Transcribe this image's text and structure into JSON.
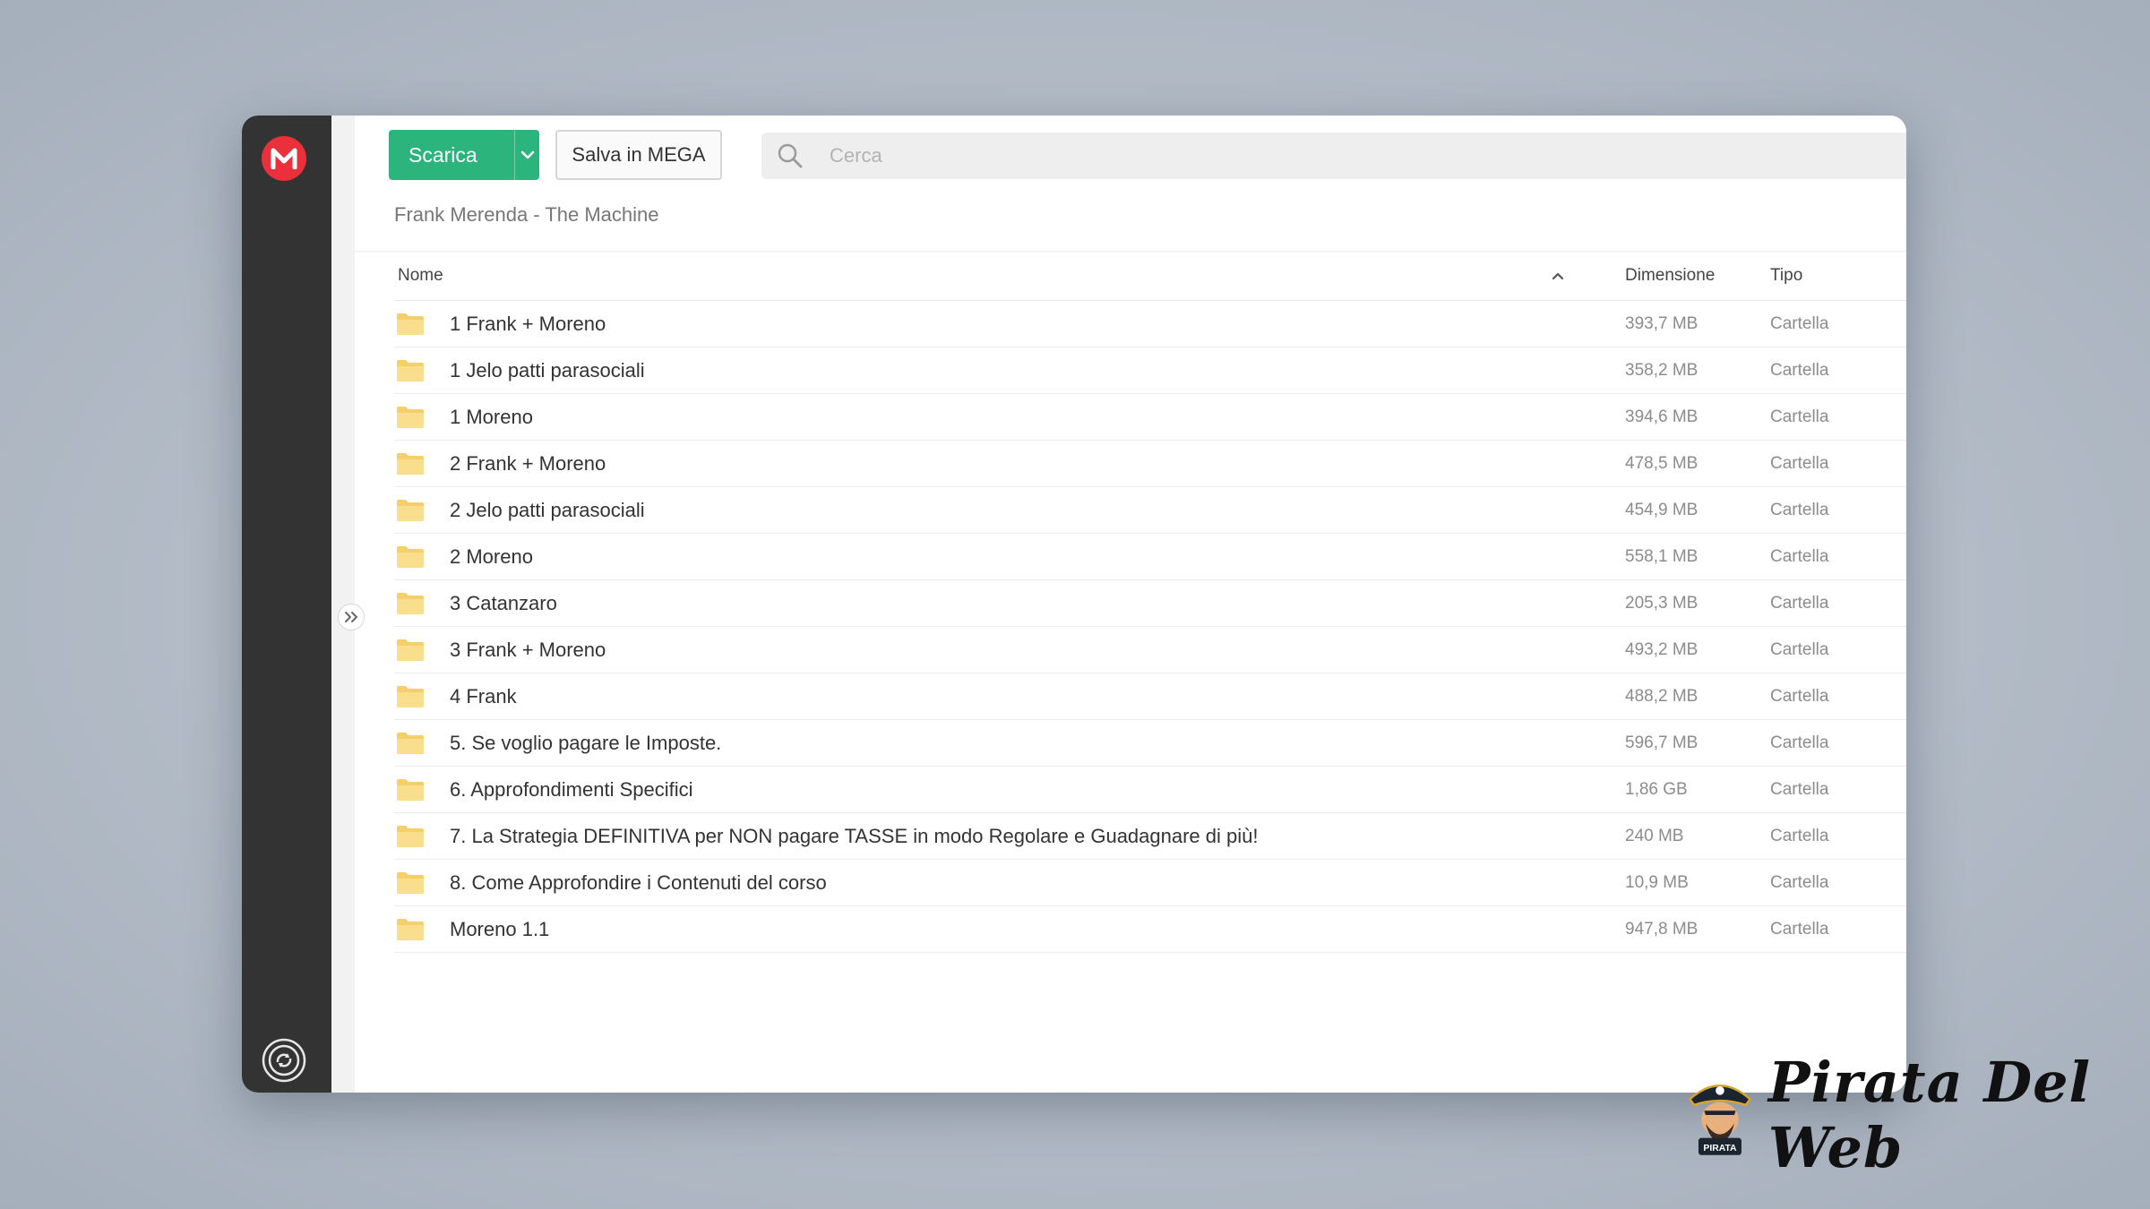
{
  "toolbar": {
    "download_label": "Scarica",
    "save_label": "Salva in MEGA",
    "search_placeholder": "Cerca"
  },
  "breadcrumb": "Frank Merenda - The Machine",
  "table": {
    "headers": {
      "name": "Nome",
      "size": "Dimensione",
      "type": "Tipo"
    },
    "rows": [
      {
        "name": "1 Frank + Moreno",
        "size": "393,7 MB",
        "type": "Cartella"
      },
      {
        "name": "1 Jelo patti parasociali",
        "size": "358,2 MB",
        "type": "Cartella"
      },
      {
        "name": "1 Moreno",
        "size": "394,6 MB",
        "type": "Cartella"
      },
      {
        "name": "2 Frank + Moreno",
        "size": "478,5 MB",
        "type": "Cartella"
      },
      {
        "name": "2 Jelo patti parasociali",
        "size": "454,9 MB",
        "type": "Cartella"
      },
      {
        "name": "2 Moreno",
        "size": "558,1 MB",
        "type": "Cartella"
      },
      {
        "name": "3 Catanzaro",
        "size": "205,3 MB",
        "type": "Cartella"
      },
      {
        "name": "3 Frank + Moreno",
        "size": "493,2 MB",
        "type": "Cartella"
      },
      {
        "name": "4 Frank",
        "size": "488,2 MB",
        "type": "Cartella"
      },
      {
        "name": "5. Se voglio pagare le Imposte.",
        "size": "596,7 MB",
        "type": "Cartella"
      },
      {
        "name": "6. Approfondimenti Specifici",
        "size": "1,86 GB",
        "type": "Cartella"
      },
      {
        "name": "7. La Strategia DEFINITIVA per NON pagare TASSE in modo Regolare e Guadagnare di più!",
        "size": "240 MB",
        "type": "Cartella"
      },
      {
        "name": "8. Come Approfondire i Contenuti del corso",
        "size": "10,9 MB",
        "type": "Cartella"
      },
      {
        "name": "Moreno 1.1",
        "size": "947,8 MB",
        "type": "Cartella"
      }
    ]
  },
  "brand": {
    "name": "Pirata Del Web",
    "badge": "PIRATA"
  },
  "colors": {
    "accent_green": "#2bb57d",
    "mega_red": "#e9303b",
    "sidebar": "#333333",
    "folder": "#f5cf6a"
  },
  "icons": {
    "logo": "mega-logo-icon",
    "sync": "sync-icon",
    "expand": "double-chevron-right-icon",
    "search": "search-icon",
    "folder": "folder-icon",
    "sort": "sort-asc-icon"
  }
}
